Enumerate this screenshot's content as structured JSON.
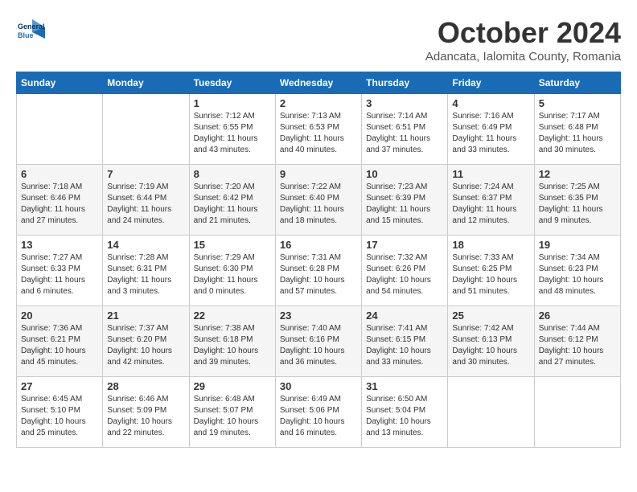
{
  "header": {
    "logo_line1": "General",
    "logo_line2": "Blue",
    "month_title": "October 2024",
    "subtitle": "Adancata, Ialomita County, Romania"
  },
  "days_of_week": [
    "Sunday",
    "Monday",
    "Tuesday",
    "Wednesday",
    "Thursday",
    "Friday",
    "Saturday"
  ],
  "weeks": [
    [
      {
        "day": "",
        "info": ""
      },
      {
        "day": "",
        "info": ""
      },
      {
        "day": "1",
        "info": "Sunrise: 7:12 AM\nSunset: 6:55 PM\nDaylight: 11 hours and 43 minutes."
      },
      {
        "day": "2",
        "info": "Sunrise: 7:13 AM\nSunset: 6:53 PM\nDaylight: 11 hours and 40 minutes."
      },
      {
        "day": "3",
        "info": "Sunrise: 7:14 AM\nSunset: 6:51 PM\nDaylight: 11 hours and 37 minutes."
      },
      {
        "day": "4",
        "info": "Sunrise: 7:16 AM\nSunset: 6:49 PM\nDaylight: 11 hours and 33 minutes."
      },
      {
        "day": "5",
        "info": "Sunrise: 7:17 AM\nSunset: 6:48 PM\nDaylight: 11 hours and 30 minutes."
      }
    ],
    [
      {
        "day": "6",
        "info": "Sunrise: 7:18 AM\nSunset: 6:46 PM\nDaylight: 11 hours and 27 minutes."
      },
      {
        "day": "7",
        "info": "Sunrise: 7:19 AM\nSunset: 6:44 PM\nDaylight: 11 hours and 24 minutes."
      },
      {
        "day": "8",
        "info": "Sunrise: 7:20 AM\nSunset: 6:42 PM\nDaylight: 11 hours and 21 minutes."
      },
      {
        "day": "9",
        "info": "Sunrise: 7:22 AM\nSunset: 6:40 PM\nDaylight: 11 hours and 18 minutes."
      },
      {
        "day": "10",
        "info": "Sunrise: 7:23 AM\nSunset: 6:39 PM\nDaylight: 11 hours and 15 minutes."
      },
      {
        "day": "11",
        "info": "Sunrise: 7:24 AM\nSunset: 6:37 PM\nDaylight: 11 hours and 12 minutes."
      },
      {
        "day": "12",
        "info": "Sunrise: 7:25 AM\nSunset: 6:35 PM\nDaylight: 11 hours and 9 minutes."
      }
    ],
    [
      {
        "day": "13",
        "info": "Sunrise: 7:27 AM\nSunset: 6:33 PM\nDaylight: 11 hours and 6 minutes."
      },
      {
        "day": "14",
        "info": "Sunrise: 7:28 AM\nSunset: 6:31 PM\nDaylight: 11 hours and 3 minutes."
      },
      {
        "day": "15",
        "info": "Sunrise: 7:29 AM\nSunset: 6:30 PM\nDaylight: 11 hours and 0 minutes."
      },
      {
        "day": "16",
        "info": "Sunrise: 7:31 AM\nSunset: 6:28 PM\nDaylight: 10 hours and 57 minutes."
      },
      {
        "day": "17",
        "info": "Sunrise: 7:32 AM\nSunset: 6:26 PM\nDaylight: 10 hours and 54 minutes."
      },
      {
        "day": "18",
        "info": "Sunrise: 7:33 AM\nSunset: 6:25 PM\nDaylight: 10 hours and 51 minutes."
      },
      {
        "day": "19",
        "info": "Sunrise: 7:34 AM\nSunset: 6:23 PM\nDaylight: 10 hours and 48 minutes."
      }
    ],
    [
      {
        "day": "20",
        "info": "Sunrise: 7:36 AM\nSunset: 6:21 PM\nDaylight: 10 hours and 45 minutes."
      },
      {
        "day": "21",
        "info": "Sunrise: 7:37 AM\nSunset: 6:20 PM\nDaylight: 10 hours and 42 minutes."
      },
      {
        "day": "22",
        "info": "Sunrise: 7:38 AM\nSunset: 6:18 PM\nDaylight: 10 hours and 39 minutes."
      },
      {
        "day": "23",
        "info": "Sunrise: 7:40 AM\nSunset: 6:16 PM\nDaylight: 10 hours and 36 minutes."
      },
      {
        "day": "24",
        "info": "Sunrise: 7:41 AM\nSunset: 6:15 PM\nDaylight: 10 hours and 33 minutes."
      },
      {
        "day": "25",
        "info": "Sunrise: 7:42 AM\nSunset: 6:13 PM\nDaylight: 10 hours and 30 minutes."
      },
      {
        "day": "26",
        "info": "Sunrise: 7:44 AM\nSunset: 6:12 PM\nDaylight: 10 hours and 27 minutes."
      }
    ],
    [
      {
        "day": "27",
        "info": "Sunrise: 6:45 AM\nSunset: 5:10 PM\nDaylight: 10 hours and 25 minutes."
      },
      {
        "day": "28",
        "info": "Sunrise: 6:46 AM\nSunset: 5:09 PM\nDaylight: 10 hours and 22 minutes."
      },
      {
        "day": "29",
        "info": "Sunrise: 6:48 AM\nSunset: 5:07 PM\nDaylight: 10 hours and 19 minutes."
      },
      {
        "day": "30",
        "info": "Sunrise: 6:49 AM\nSunset: 5:06 PM\nDaylight: 10 hours and 16 minutes."
      },
      {
        "day": "31",
        "info": "Sunrise: 6:50 AM\nSunset: 5:04 PM\nDaylight: 10 hours and 13 minutes."
      },
      {
        "day": "",
        "info": ""
      },
      {
        "day": "",
        "info": ""
      }
    ]
  ]
}
